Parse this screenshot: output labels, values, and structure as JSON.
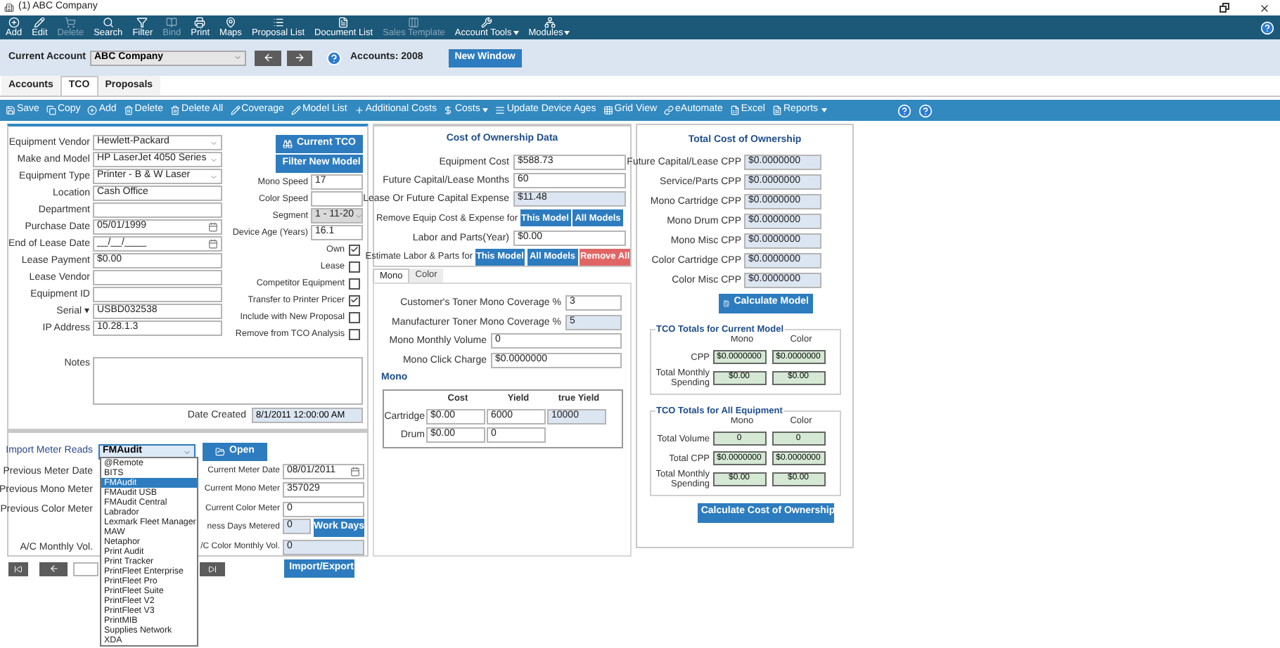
{
  "window": {
    "title": "(1) ABC Company"
  },
  "toolbar": [
    {
      "label": "Add",
      "disabled": false,
      "menu": false
    },
    {
      "label": "Edit",
      "disabled": false,
      "menu": false
    },
    {
      "label": "Delete",
      "disabled": true,
      "menu": false
    },
    {
      "label": "Search",
      "disabled": false,
      "menu": false
    },
    {
      "label": "Filter",
      "disabled": false,
      "menu": false
    },
    {
      "label": "Bind",
      "disabled": true,
      "menu": false
    },
    {
      "label": "Print",
      "disabled": false,
      "menu": false
    },
    {
      "label": "Maps",
      "disabled": false,
      "menu": false
    },
    {
      "label": "Proposal List",
      "disabled": false,
      "menu": false
    },
    {
      "label": "Document List",
      "disabled": false,
      "menu": false
    },
    {
      "label": "Sales Template",
      "disabled": true,
      "menu": false
    },
    {
      "label": "Account Tools",
      "disabled": false,
      "menu": true
    },
    {
      "label": "Modules",
      "disabled": false,
      "menu": true
    }
  ],
  "account_bar": {
    "label": "Current Account",
    "account": "ABC Company",
    "count": "Accounts: 2008",
    "new_window": "New Window"
  },
  "tabs": [
    {
      "label": "Accounts",
      "selected": false
    },
    {
      "label": "TCO",
      "selected": true
    },
    {
      "label": "Proposals",
      "selected": false
    }
  ],
  "actions": [
    {
      "label": "Save",
      "menu": false
    },
    {
      "label": "Copy",
      "menu": false
    },
    {
      "label": "Add",
      "menu": false
    },
    {
      "label": "Delete",
      "menu": false
    },
    {
      "label": "Delete All",
      "menu": false
    },
    {
      "label": "Coverage",
      "menu": false
    },
    {
      "label": "Model List",
      "menu": false
    },
    {
      "label": "Additional Costs",
      "menu": false
    },
    {
      "label": "Costs",
      "menu": true
    },
    {
      "label": "Update Device Ages",
      "menu": false
    },
    {
      "label": "Grid View",
      "menu": false
    },
    {
      "label": "eAutomate",
      "menu": false
    },
    {
      "label": "Excel",
      "menu": false
    },
    {
      "label": "Reports",
      "menu": true
    }
  ],
  "equipment": {
    "fields": [
      {
        "label": "Equipment Vendor",
        "value": "Hewlett-Packard",
        "kind": "select"
      },
      {
        "label": "Make and Model",
        "value": "HP LaserJet 4050 Series",
        "kind": "select"
      },
      {
        "label": "Equipment Type",
        "value": "Printer - B & W Laser",
        "kind": "select"
      },
      {
        "label": "Location",
        "value": "Cash Office",
        "kind": "text"
      },
      {
        "label": "Department",
        "kind": "text"
      },
      {
        "label": "Purchase Date",
        "value": "05/01/1999",
        "kind": "date"
      },
      {
        "label": "End of Lease Date",
        "value": "__/__/____",
        "kind": "date"
      },
      {
        "label": "Lease Payment",
        "value": "$0.00",
        "kind": "text"
      },
      {
        "label": "Lease Vendor",
        "kind": "text"
      },
      {
        "label": "Equipment ID",
        "kind": "text"
      },
      {
        "label": "Serial ▾",
        "value": "USBD032538",
        "kind": "text"
      },
      {
        "label": "IP Address",
        "value": "10.28.1.3",
        "kind": "text"
      }
    ],
    "buttons": [
      "Current TCO",
      "Filter New Model"
    ],
    "specs": [
      {
        "label": "Mono Speed",
        "value": "17",
        "kind": "text"
      },
      {
        "label": "Color Speed",
        "kind": "text"
      },
      {
        "label": "Segment",
        "value": "1 - 11-20",
        "kind": "select"
      },
      {
        "label": "Device Age (Years)",
        "value": "16.1",
        "kind": "text"
      }
    ],
    "checkboxes": [
      {
        "label": "Own",
        "checked": true
      },
      {
        "label": "Lease",
        "checked": false
      },
      {
        "label": "Competitor Equipment",
        "checked": false
      },
      {
        "label": "Transfer to Printer Pricer",
        "checked": true
      },
      {
        "label": "Include with New Proposal",
        "checked": false
      },
      {
        "label": "Remove from TCO Analysis",
        "checked": false
      }
    ],
    "notes": {
      "label": "Notes"
    },
    "date_created": {
      "label": "Date Created",
      "value": "8/1/2011 12:00:00 AM"
    }
  },
  "cost_data": {
    "title": "Cost of Ownership Data",
    "rows": [
      {
        "kind": "field",
        "label": "Equipment Cost",
        "value": "$588.73",
        "readonly": false
      },
      {
        "kind": "field",
        "label": "Future Capital/Lease Months",
        "value": "60",
        "readonly": false
      },
      {
        "kind": "field",
        "label": "Lease Or Future Capital Expense",
        "value": "$11.48",
        "readonly": true
      },
      {
        "kind": "buttons",
        "label": "Remove Equip Cost & Expense for",
        "buttons": [
          {
            "label": "This Model",
            "danger": false
          },
          {
            "label": "All Models",
            "danger": false
          }
        ]
      },
      {
        "kind": "field",
        "label": "Labor and Parts(Year)",
        "value": "$0.00",
        "readonly": false
      },
      {
        "kind": "buttons",
        "label": "Estimate Labor & Parts for",
        "buttons": [
          {
            "label": "This Model",
            "danger": false
          },
          {
            "label": "All Models",
            "danger": false
          },
          {
            "label": "Remove All",
            "danger": true
          }
        ]
      }
    ]
  },
  "toner_tabs": [
    {
      "label": "Mono",
      "selected": true
    },
    {
      "label": "Color",
      "selected": false
    }
  ],
  "toner": {
    "rows": [
      {
        "label": "Customer's Toner Mono Coverage %",
        "value": "3",
        "readonly": false,
        "short": true
      },
      {
        "label": "Manufacturer Toner Mono Coverage %",
        "value": "5",
        "readonly": true,
        "short": true
      },
      {
        "label": "Mono Monthly Volume",
        "value": "0",
        "readonly": false,
        "short": false
      },
      {
        "label": "Mono Click Charge",
        "value": "$0.0000000",
        "readonly": false,
        "short": false
      }
    ],
    "section": "Mono",
    "columns": [
      "Cost",
      "Yield",
      "true Yield"
    ],
    "supplies": [
      {
        "label": "Cartridge",
        "cells": [
          {
            "value": "$0.00",
            "readonly": false
          },
          {
            "value": "6000",
            "readonly": false
          },
          {
            "value": "10000",
            "readonly": true
          }
        ]
      },
      {
        "label": "Drum",
        "cells": [
          {
            "value": "$0.00",
            "readonly": false
          },
          {
            "value": "0",
            "readonly": false
          }
        ]
      }
    ]
  },
  "tco": {
    "title": "Total Cost of Ownership",
    "rows": [
      {
        "label": "Future Capital/Lease CPP",
        "value": "$0.0000000"
      },
      {
        "label": "Service/Parts CPP",
        "value": "$0.0000000"
      },
      {
        "label": "Mono Cartridge CPP",
        "value": "$0.0000000"
      },
      {
        "label": "Mono Drum CPP",
        "value": "$0.0000000"
      },
      {
        "label": "Mono Misc CPP",
        "value": "$0.0000000"
      },
      {
        "label": "Color Cartridge CPP",
        "value": "$0.0000000"
      },
      {
        "label": "Color Misc CPP",
        "value": "$0.0000000"
      }
    ],
    "calculate": "Calculate Model",
    "groups": [
      {
        "title": "TCO Totals for Current Model",
        "columns": [
          "Mono",
          "Color"
        ],
        "rows": [
          {
            "label": "CPP",
            "values": [
              "$0.0000000",
              "$0.0000000"
            ]
          },
          {
            "label": "Total Monthly Spending",
            "values": [
              "$0.00",
              "$0.00"
            ]
          }
        ]
      },
      {
        "title": "TCO Totals for All Equipment",
        "columns": [
          "Mono",
          "Color"
        ],
        "rows": [
          {
            "label": "Total Volume",
            "values": [
              "0",
              "0"
            ]
          },
          {
            "label": "Total CPP",
            "values": [
              "$0.0000000",
              "$0.0000000"
            ]
          },
          {
            "label": "Total Monthly Spending",
            "values": [
              "$0.00",
              "$0.00"
            ]
          }
        ]
      }
    ],
    "calculate_all": "Calculate Cost of Ownership"
  },
  "meter_reads": {
    "label": "Import Meter Reads",
    "source": "FMAudit",
    "expanded": true,
    "open": "Open",
    "options": [
      {
        "label": "@Remote",
        "selected": false
      },
      {
        "label": "BITS",
        "selected": false
      },
      {
        "label": "FMAudit",
        "selected": true
      },
      {
        "label": "FMAudit USB",
        "selected": false
      },
      {
        "label": "FMAudit Central",
        "selected": false
      },
      {
        "label": "Labrador",
        "selected": false
      },
      {
        "label": "Lexmark Fleet Manager",
        "selected": false
      },
      {
        "label": "MAW",
        "selected": false
      },
      {
        "label": "Netaphor",
        "selected": false
      },
      {
        "label": "Print Audit",
        "selected": false
      },
      {
        "label": "Print Tracker",
        "selected": false
      },
      {
        "label": "PrintFleet Enterprise",
        "selected": false
      },
      {
        "label": "PrintFleet Pro",
        "selected": false
      },
      {
        "label": "PrintFleet Suite",
        "selected": false
      },
      {
        "label": "PrintFleet V2",
        "selected": false
      },
      {
        "label": "PrintFleet V3",
        "selected": false
      },
      {
        "label": "PrintMIB",
        "selected": false
      },
      {
        "label": "Supplies Network",
        "selected": false
      },
      {
        "label": "XDA",
        "selected": false
      }
    ],
    "rows": [
      {
        "left": "Previous Meter Date",
        "right": {
          "label": "Current Meter Date",
          "value": "08/01/2011",
          "kind": "date"
        }
      },
      {
        "left": "Previous Mono Meter",
        "right": {
          "label": "Current Mono Meter",
          "value": "357029",
          "kind": "text"
        }
      },
      {
        "left": "Previous Color Meter",
        "right": {
          "label": "Current Color Meter",
          "value": "0",
          "kind": "text"
        }
      },
      {
        "right": {
          "label": "ness Days Metered",
          "value": "0",
          "kind": "readonly",
          "button": "Work Days"
        }
      },
      {
        "left": "A/C Monthly Vol.",
        "right": {
          "label": "/C Color Monthly Vol.",
          "value": "0",
          "kind": "readonly"
        }
      }
    ]
  },
  "navigation": {
    "import_export": "Import/Export"
  }
}
